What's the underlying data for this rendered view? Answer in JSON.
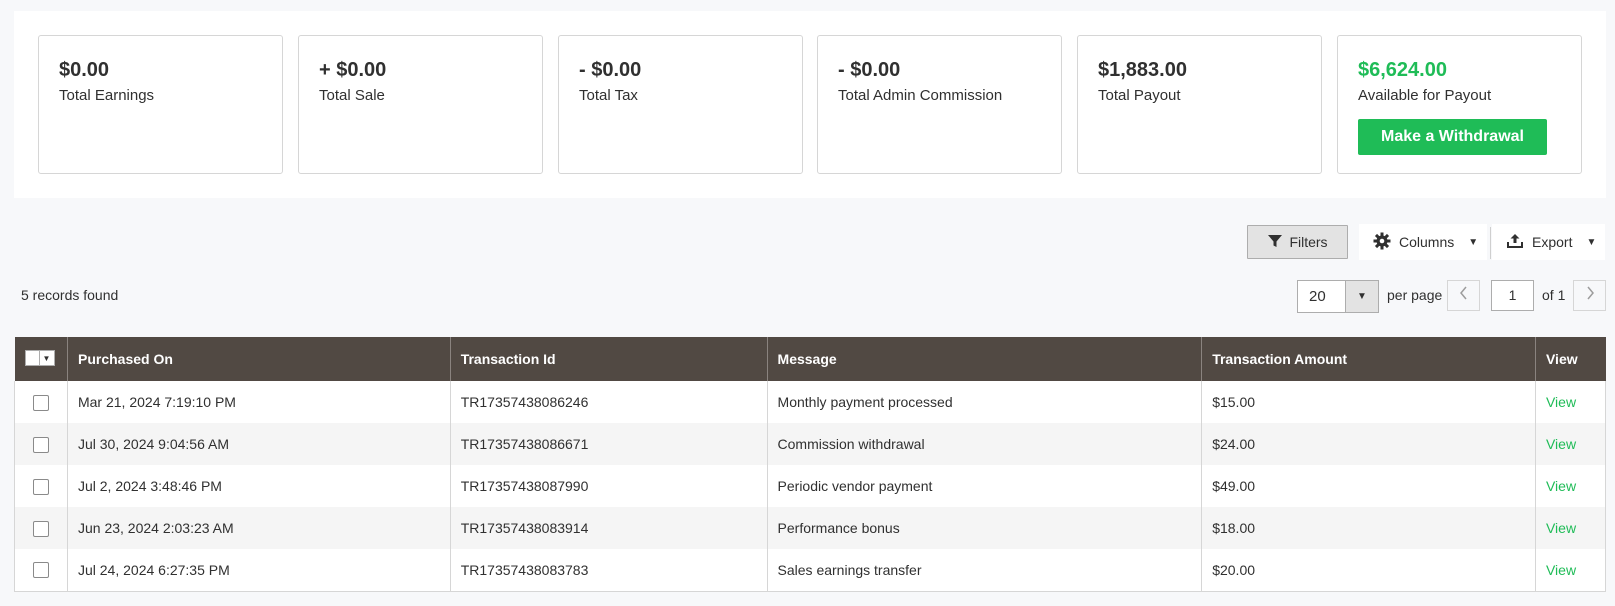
{
  "summary": {
    "cards": [
      {
        "amount": "$0.00",
        "label": "Total Earnings"
      },
      {
        "amount": "+ $0.00",
        "label": "Total Sale"
      },
      {
        "amount": "- $0.00",
        "label": "Total Tax"
      },
      {
        "amount": "- $0.00",
        "label": "Total Admin Commission"
      },
      {
        "amount": "$1,883.00",
        "label": "Total Payout"
      },
      {
        "amount": "$6,624.00",
        "label": "Available for Payout"
      }
    ],
    "withdraw_label": "Make a Withdrawal"
  },
  "toolbar": {
    "filters_label": "Filters",
    "columns_label": "Columns",
    "export_label": "Export"
  },
  "grid": {
    "records_found": "5 records found",
    "per_page_value": "20",
    "per_page_label": "per page",
    "current_page": "1",
    "page_of": "of 1",
    "columns": [
      "Purchased On",
      "Transaction Id",
      "Message",
      "Transaction Amount",
      "View"
    ],
    "rows": [
      {
        "purchased_on": "Mar 21, 2024 7:19:10 PM",
        "transaction_id": "TR17357438086246",
        "message": "Monthly payment processed",
        "amount": "$15.00",
        "view": "View"
      },
      {
        "purchased_on": "Jul 30, 2024 9:04:56 AM",
        "transaction_id": "TR17357438086671",
        "message": "Commission withdrawal",
        "amount": "$24.00",
        "view": "View"
      },
      {
        "purchased_on": "Jul 2, 2024 3:48:46 PM",
        "transaction_id": "TR17357438087990",
        "message": "Periodic vendor payment",
        "amount": "$49.00",
        "view": "View"
      },
      {
        "purchased_on": "Jun 23, 2024 2:03:23 AM",
        "transaction_id": "TR17357438083914",
        "message": "Performance bonus",
        "amount": "$18.00",
        "view": "View"
      },
      {
        "purchased_on": "Jul 24, 2024 6:27:35 PM",
        "transaction_id": "TR17357438083783",
        "message": "Sales earnings transfer",
        "amount": "$20.00",
        "view": "View"
      }
    ]
  },
  "colors": {
    "accent_green": "#1fbc57",
    "header_bg": "#514943"
  }
}
